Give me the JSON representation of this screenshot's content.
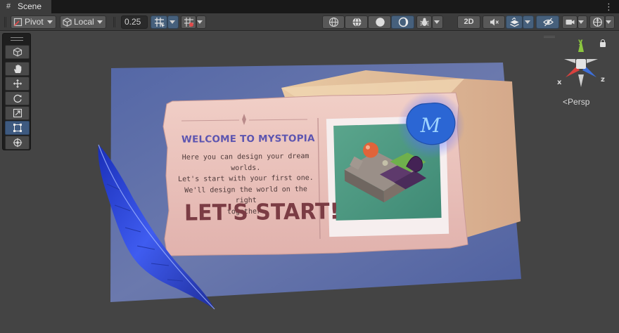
{
  "window": {
    "tab_label": "Scene",
    "tab_icon": "hash-icon",
    "menu_icon": "kebab-menu-icon"
  },
  "toolbar": {
    "pivot_label": "Pivot",
    "space_label": "Local",
    "snap_value": "0.25",
    "mode_2d_label": "2D",
    "left_group": [
      "pivot-toggle",
      "space-toggle",
      "snap-increment",
      "grid-snapping-toggle",
      "grid-visibility-toggle"
    ],
    "right_group": [
      "wireframe-shading",
      "shaded-wireframe-shading",
      "shaded-shading",
      "unlit-shading",
      "debug-draw-mode",
      "2d-toggle",
      "audio-toggle",
      "effects-toggle",
      "visibility-toggle",
      "camera-settings",
      "gizmos-toggle"
    ]
  },
  "tools": [
    {
      "name": "view-cube-tool",
      "icon": "cube-icon",
      "active": false
    },
    {
      "name": "hand-tool",
      "icon": "hand-icon",
      "active": false
    },
    {
      "name": "move-tool",
      "icon": "move-icon",
      "active": false
    },
    {
      "name": "rotate-tool",
      "icon": "rotate-icon",
      "active": false
    },
    {
      "name": "scale-tool",
      "icon": "scale-icon",
      "active": false
    },
    {
      "name": "rect-tool",
      "icon": "rect-icon",
      "active": true
    },
    {
      "name": "transform-tool",
      "icon": "transform-icon",
      "active": false
    }
  ],
  "gizmo": {
    "axis_y": "y",
    "axis_x": "x",
    "axis_z": "z",
    "projection_label": "Persp",
    "colors": {
      "x": "#d9413e",
      "y": "#8cc63f",
      "z": "#3d6fd9"
    }
  },
  "card": {
    "title": "WELCOME TO MYSTOPIA",
    "body_lines": [
      "Here you can design your dream worlds.",
      "Let's start with your first one.",
      "We'll design the world on the right",
      "together."
    ],
    "cta": "LET'S START!",
    "seal_letter": "M"
  },
  "colors": {
    "accent_active": "#46607c",
    "scene_bg": "#444444",
    "card_pink": "#e9c2bd",
    "backdrop_blue": "#5b6da6"
  }
}
